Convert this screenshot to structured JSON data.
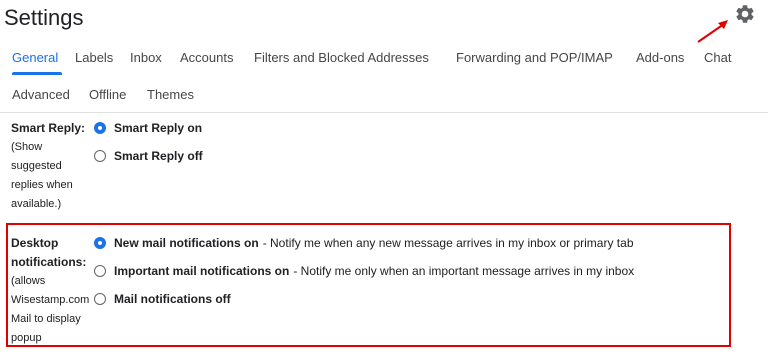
{
  "header": {
    "title": "Settings"
  },
  "tabs": {
    "row1": [
      "General",
      "Labels",
      "Inbox",
      "Accounts",
      "Filters and Blocked Addresses",
      "Forwarding and POP/IMAP",
      "Add-ons",
      "Chat"
    ],
    "row2": [
      "Advanced",
      "Offline",
      "Themes"
    ],
    "active": "General"
  },
  "smart_reply": {
    "label": "Smart Reply:",
    "description_lines": [
      "(Show",
      "suggested",
      "replies when",
      "available.)"
    ],
    "options": [
      {
        "label": "Smart Reply on",
        "detail": "",
        "selected": true
      },
      {
        "label": "Smart Reply off",
        "detail": "",
        "selected": false
      }
    ]
  },
  "desktop_notifications": {
    "label_lines": [
      "Desktop",
      "notifications:"
    ],
    "description_lines": [
      "(allows",
      "Wisestamp.com",
      "Mail to display",
      "popup"
    ],
    "options": [
      {
        "label": "New mail notifications on",
        "detail": "- Notify me when any new message arrives in my inbox or primary tab",
        "selected": true
      },
      {
        "label": "Important mail notifications on",
        "detail": "- Notify me only when an important message arrives in my inbox",
        "selected": false
      },
      {
        "label": "Mail notifications off",
        "detail": "",
        "selected": false
      }
    ]
  },
  "colors": {
    "accent": "#1a73e8",
    "annotation": "#e00000",
    "text": "#202124",
    "tab_text": "#444746"
  }
}
